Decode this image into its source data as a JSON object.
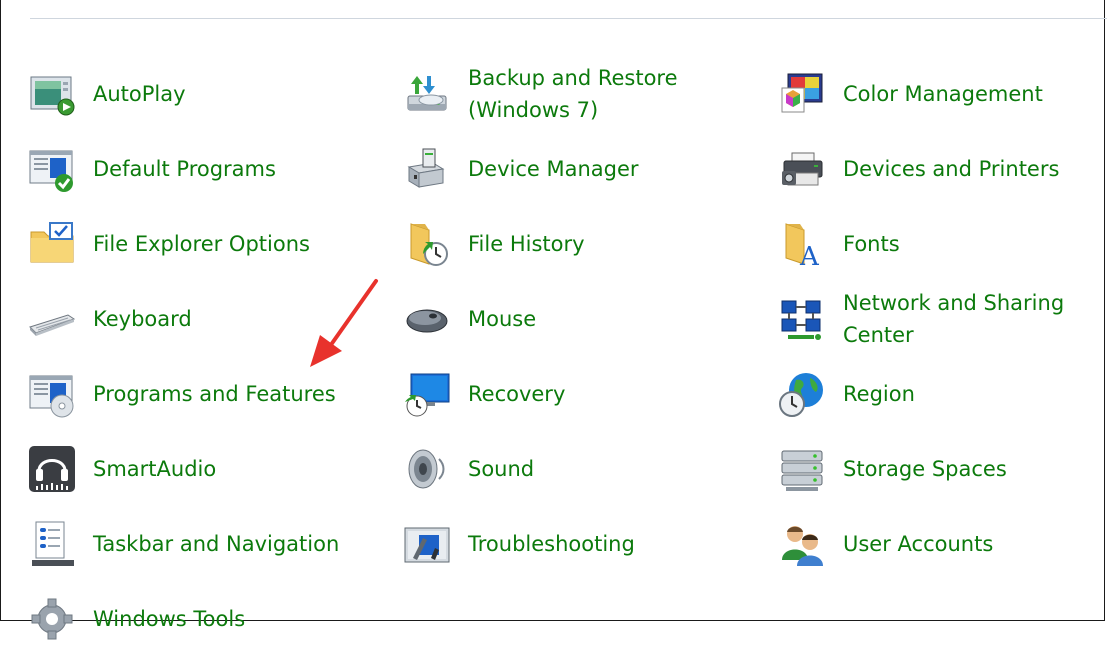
{
  "items": [
    {
      "label": "AutoPlay",
      "icon": "autoplay-icon"
    },
    {
      "label": "Backup and Restore\n(Windows 7)",
      "icon": "backup-restore-icon"
    },
    {
      "label": "Color Management",
      "icon": "color-management-icon"
    },
    {
      "label": "Default Programs",
      "icon": "default-programs-icon"
    },
    {
      "label": "Device Manager",
      "icon": "device-manager-icon"
    },
    {
      "label": "Devices and Printers",
      "icon": "printer-icon"
    },
    {
      "label": "File Explorer Options",
      "icon": "folder-options-icon"
    },
    {
      "label": "File History",
      "icon": "file-history-icon"
    },
    {
      "label": "Fonts",
      "icon": "fonts-icon"
    },
    {
      "label": "Keyboard",
      "icon": "keyboard-icon"
    },
    {
      "label": "Mouse",
      "icon": "mouse-icon"
    },
    {
      "label": "Network and Sharing\nCenter",
      "icon": "network-icon"
    },
    {
      "label": "Programs and Features",
      "icon": "programs-features-icon"
    },
    {
      "label": "Recovery",
      "icon": "recovery-icon"
    },
    {
      "label": "Region",
      "icon": "globe-clock-icon"
    },
    {
      "label": "SmartAudio",
      "icon": "headphones-icon"
    },
    {
      "label": "Sound",
      "icon": "speaker-icon"
    },
    {
      "label": "Storage Spaces",
      "icon": "storage-icon"
    },
    {
      "label": "Taskbar and Navigation",
      "icon": "taskbar-icon"
    },
    {
      "label": "Troubleshooting",
      "icon": "troubleshooting-icon"
    },
    {
      "label": "User Accounts",
      "icon": "users-icon"
    },
    {
      "label": "Windows Tools",
      "icon": "gear-icon"
    }
  ],
  "colors": {
    "link": "#0c7a0c",
    "arrow": "#e8322c"
  }
}
